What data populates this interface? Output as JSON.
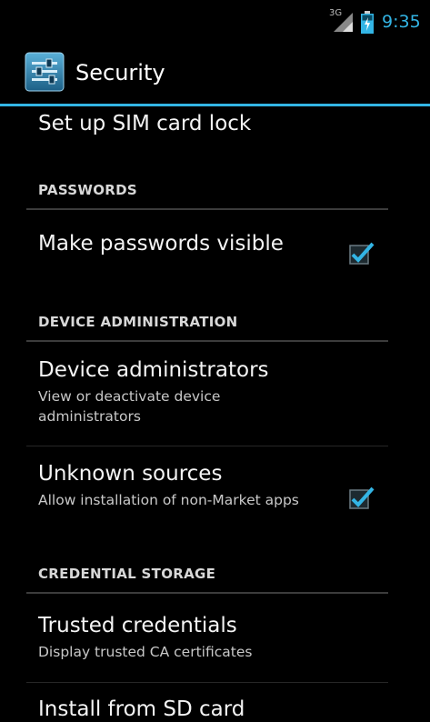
{
  "status_bar": {
    "network_label": "3G",
    "time": "9:35",
    "icons": [
      "signal-icon",
      "battery-icon"
    ],
    "accent_color": "#33b5e5"
  },
  "action_bar": {
    "app_icon": "settings-icon",
    "title": "Security"
  },
  "rows": {
    "sim_lock": {
      "title": "Set up SIM card lock"
    },
    "passwords_header": "PASSWORDS",
    "make_passwords_visible": {
      "title": "Make passwords visible",
      "checked": true
    },
    "device_admin_header": "DEVICE ADMINISTRATION",
    "device_administrators": {
      "title": "Device administrators",
      "summary": "View or deactivate device administrators"
    },
    "unknown_sources": {
      "title": "Unknown sources",
      "summary": "Allow installation of non-Market apps",
      "checked": true
    },
    "credential_storage_header": "CREDENTIAL STORAGE",
    "trusted_credentials": {
      "title": "Trusted credentials",
      "summary": "Display trusted CA certificates"
    },
    "install_from_sd": {
      "title": "Install from SD card"
    }
  }
}
